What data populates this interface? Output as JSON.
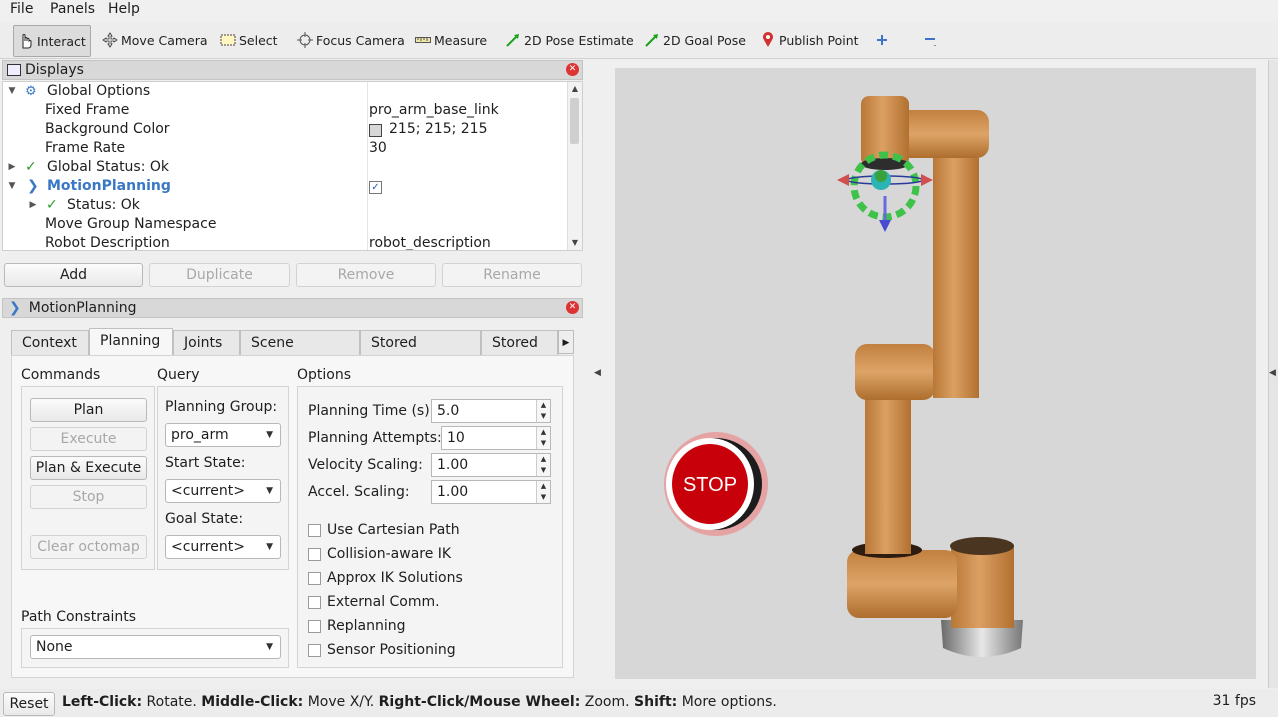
{
  "menu": {
    "file": "File",
    "panels": "Panels",
    "help": "Help"
  },
  "toolbar": {
    "interact": "Interact",
    "move_camera": "Move Camera",
    "select": "Select",
    "focus_camera": "Focus Camera",
    "measure": "Measure",
    "pose_estimate": "2D Pose Estimate",
    "goal_pose": "2D Goal Pose",
    "publish_point": "Publish Point"
  },
  "displays": {
    "title": "Displays",
    "rows": [
      {
        "label": "Global Options",
        "value": ""
      },
      {
        "label": "Fixed Frame",
        "value": "pro_arm_base_link"
      },
      {
        "label": "Background Color",
        "value": "215; 215; 215"
      },
      {
        "label": "Frame Rate",
        "value": "30"
      },
      {
        "label": "Global Status: Ok",
        "value": ""
      },
      {
        "label": "MotionPlanning",
        "value": ""
      },
      {
        "label": "Status: Ok",
        "value": ""
      },
      {
        "label": "Move Group Namespace",
        "value": ""
      },
      {
        "label": "Robot Description",
        "value": "robot_description"
      }
    ],
    "buttons": {
      "add": "Add",
      "duplicate": "Duplicate",
      "remove": "Remove",
      "rename": "Rename"
    }
  },
  "motion_planning": {
    "title": "MotionPlanning",
    "tabs": [
      "Context",
      "Planning",
      "Joints",
      "Scene Objects",
      "Stored Scenes",
      "Stored S"
    ],
    "commands": {
      "heading": "Commands",
      "plan": "Plan",
      "execute": "Execute",
      "plan_execute": "Plan & Execute",
      "stop": "Stop",
      "clear_octomap": "Clear octomap"
    },
    "query": {
      "heading": "Query",
      "planning_group_label": "Planning Group:",
      "planning_group": "pro_arm",
      "start_state_label": "Start State:",
      "start_state": "<current>",
      "goal_state_label": "Goal State:",
      "goal_state": "<current>"
    },
    "options": {
      "heading": "Options",
      "planning_time_label": "Planning Time (s):",
      "planning_time": "5.0",
      "planning_attempts_label": "Planning Attempts:",
      "planning_attempts": "10",
      "velocity_scaling_label": "Velocity Scaling:",
      "velocity_scaling": "1.00",
      "accel_scaling_label": "Accel. Scaling:",
      "accel_scaling": "1.00",
      "checkboxes": [
        "Use Cartesian Path",
        "Collision-aware IK",
        "Approx IK Solutions",
        "External Comm.",
        "Replanning",
        "Sensor Positioning"
      ]
    },
    "path_constraints": {
      "label": "Path Constraints",
      "value": "None"
    }
  },
  "viewport": {
    "stop_label": "STOP",
    "background_color": "#d7d7d7",
    "arm_color": "#d4934f"
  },
  "status": {
    "reset": "Reset",
    "left_key": "Left-Click:",
    "left_val": " Rotate. ",
    "middle_key": "Middle-Click:",
    "middle_val": " Move X/Y. ",
    "right_key": "Right-Click/Mouse Wheel:",
    "right_val": " Zoom. ",
    "shift_key": "Shift:",
    "shift_val": " More options.",
    "fps": "31 fps"
  }
}
